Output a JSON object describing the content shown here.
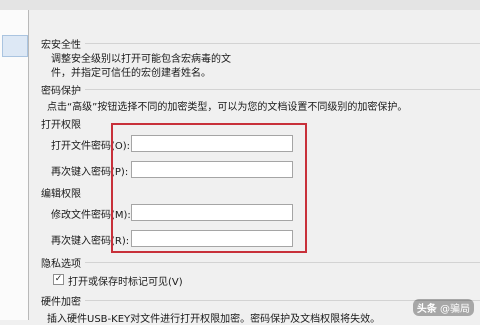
{
  "macro_security": {
    "title": "宏安全性",
    "desc_line1": "调整安全级别以打开可能包含宏病毒的文",
    "desc_line2": "件，并指定可信任的宏创建者姓名。"
  },
  "password_protection": {
    "title": "密码保护",
    "desc": "点击“高级”按钮选择不同的加密类型，可以为您的文档设置不同级别的加密保护。",
    "open_permission": {
      "title": "打开权限",
      "open_password_label": "打开文件密码(O):",
      "open_password_value": "",
      "reenter_label": "再次键入密码(P):",
      "reenter_value": ""
    },
    "edit_permission": {
      "title": "编辑权限",
      "modify_password_label": "修改文件密码(M):",
      "modify_password_value": "",
      "reenter_label": "再次键入密码(R):",
      "reenter_value": ""
    }
  },
  "privacy": {
    "title": "隐私选项",
    "checkbox_label": "打开或保存时标记可见(V)",
    "checked": true
  },
  "hardware_encryption": {
    "title": "硬件加密",
    "desc": "插入硬件USB-KEY对文件进行打开权限加密。密码保护及文档权限将失效。"
  },
  "watermark": {
    "platform": "头条",
    "account": "@骗局"
  },
  "colors": {
    "highlight_box": "#c8303a",
    "background": "#f0f0f0"
  }
}
